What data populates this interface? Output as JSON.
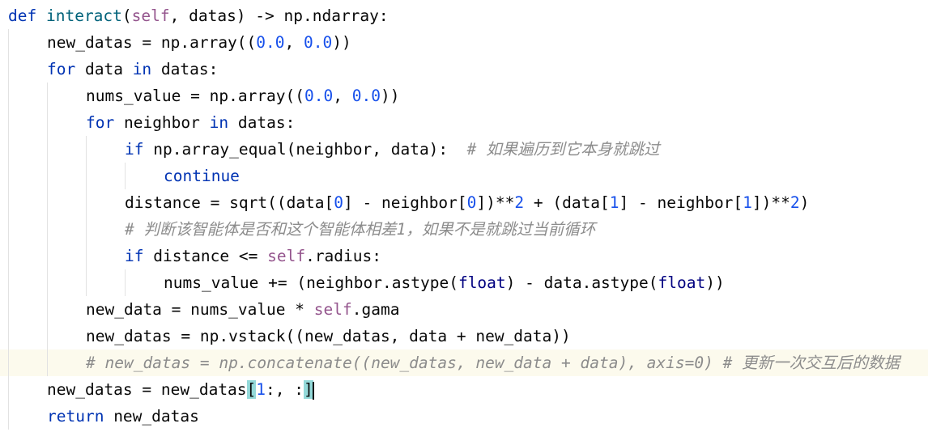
{
  "editor": {
    "language": "python",
    "current_line": 14,
    "lines": [
      {
        "indent": 0,
        "tokens": [
          {
            "t": "def",
            "c": "kw"
          },
          {
            "t": " "
          },
          {
            "t": "interact",
            "c": "fn"
          },
          {
            "t": "("
          },
          {
            "t": "self",
            "c": "slf"
          },
          {
            "t": ", datas) -> np.ndarray:"
          }
        ]
      },
      {
        "indent": 1,
        "tokens": [
          {
            "t": "new_datas = np.array(("
          },
          {
            "t": "0.0",
            "c": "num"
          },
          {
            "t": ", "
          },
          {
            "t": "0.0",
            "c": "num"
          },
          {
            "t": "))"
          }
        ]
      },
      {
        "indent": 1,
        "tokens": [
          {
            "t": "for",
            "c": "kw"
          },
          {
            "t": " data "
          },
          {
            "t": "in",
            "c": "kw"
          },
          {
            "t": " datas:"
          }
        ]
      },
      {
        "indent": 2,
        "tokens": [
          {
            "t": "nums_value = np.array(("
          },
          {
            "t": "0.0",
            "c": "num"
          },
          {
            "t": ", "
          },
          {
            "t": "0.0",
            "c": "num"
          },
          {
            "t": "))"
          }
        ]
      },
      {
        "indent": 2,
        "tokens": [
          {
            "t": "for",
            "c": "kw"
          },
          {
            "t": " neighbor "
          },
          {
            "t": "in",
            "c": "kw"
          },
          {
            "t": " datas:"
          }
        ]
      },
      {
        "indent": 3,
        "tokens": [
          {
            "t": "if",
            "c": "kw"
          },
          {
            "t": " np.array_equal(neighbor, data):  "
          },
          {
            "t": "# 如果遍历到它本身就跳过",
            "c": "cmt"
          }
        ]
      },
      {
        "indent": 4,
        "tokens": [
          {
            "t": "continue",
            "c": "kw"
          }
        ]
      },
      {
        "indent": 3,
        "tokens": [
          {
            "t": "distance = sqrt((data["
          },
          {
            "t": "0",
            "c": "num"
          },
          {
            "t": "] - neighbor["
          },
          {
            "t": "0",
            "c": "num"
          },
          {
            "t": "])**"
          },
          {
            "t": "2",
            "c": "num"
          },
          {
            "t": " + (data["
          },
          {
            "t": "1",
            "c": "num"
          },
          {
            "t": "] - neighbor["
          },
          {
            "t": "1",
            "c": "num"
          },
          {
            "t": "])**"
          },
          {
            "t": "2",
            "c": "num"
          },
          {
            "t": ")"
          }
        ]
      },
      {
        "indent": 3,
        "tokens": [
          {
            "t": "# 判断该智能体是否和这个智能体相差1，如果不是就跳过当前循环",
            "c": "cmt"
          }
        ]
      },
      {
        "indent": 3,
        "tokens": [
          {
            "t": "if",
            "c": "kw"
          },
          {
            "t": " distance <= "
          },
          {
            "t": "self",
            "c": "slf"
          },
          {
            "t": ".radius:"
          }
        ]
      },
      {
        "indent": 4,
        "tokens": [
          {
            "t": "nums_value += (neighbor.astype("
          },
          {
            "t": "float",
            "c": "bi"
          },
          {
            "t": ") - data.astype("
          },
          {
            "t": "float",
            "c": "bi"
          },
          {
            "t": "))"
          }
        ]
      },
      {
        "indent": 2,
        "tokens": [
          {
            "t": "new_data = nums_value * "
          },
          {
            "t": "self",
            "c": "slf"
          },
          {
            "t": ".gama"
          }
        ]
      },
      {
        "indent": 2,
        "tokens": [
          {
            "t": "new_datas = np.vstack((new_datas, data + new_data))"
          }
        ]
      },
      {
        "indent": 2,
        "tokens": [
          {
            "t": "# new_datas = np.concatenate((new_datas, new_data + data), axis=0) # 更新一次交互后的数据",
            "c": "cmt"
          }
        ]
      },
      {
        "indent": 1,
        "tokens": [
          {
            "t": "new_datas = new_datas"
          },
          {
            "t": "[",
            "c": "brk"
          },
          {
            "t": "1",
            "c": "num"
          },
          {
            "t": ":, :"
          },
          {
            "t": "]",
            "c": "brk"
          },
          {
            "t": "",
            "c": "caret"
          }
        ]
      },
      {
        "indent": 1,
        "tokens": [
          {
            "t": "return",
            "c": "kw"
          },
          {
            "t": " new_datas"
          }
        ]
      }
    ]
  }
}
